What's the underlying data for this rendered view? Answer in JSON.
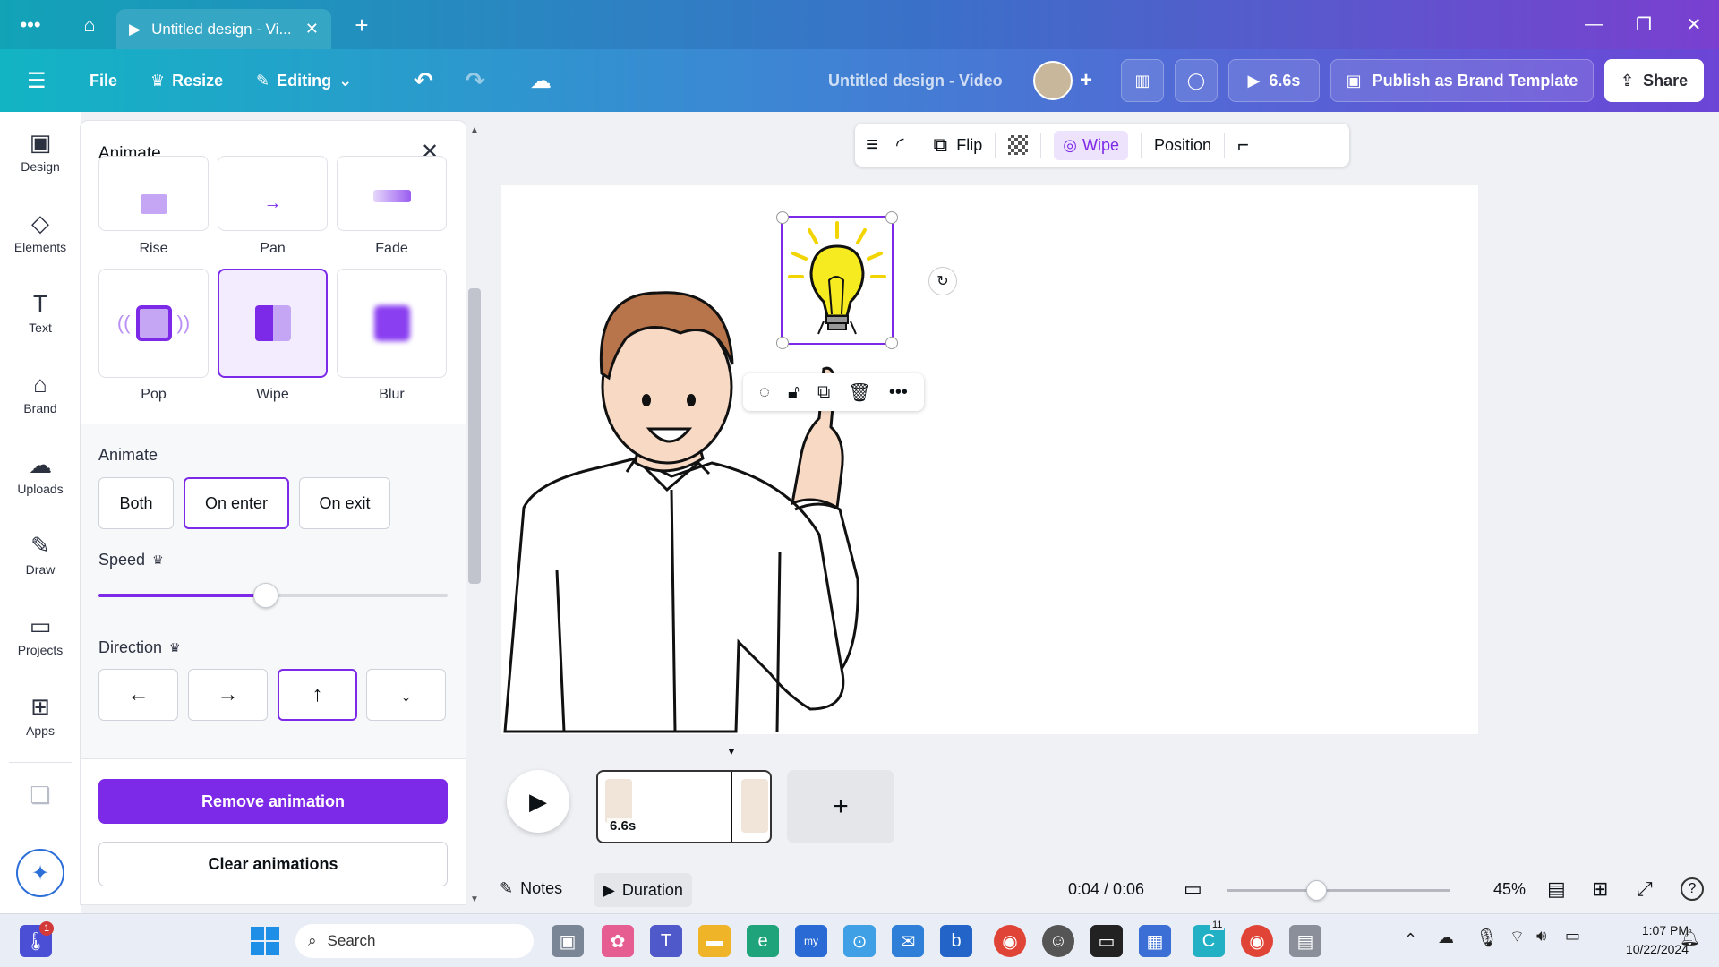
{
  "titlebar": {
    "tab_title": "Untitled design - Vi...",
    "new_tab": "+",
    "close": "✕"
  },
  "header": {
    "file": "File",
    "resize": "Resize",
    "editing": "Editing",
    "doc_title": "Untitled design - Video",
    "play_duration": "6.6s",
    "publish": "Publish as Brand Template",
    "share": "Share"
  },
  "rail": {
    "items": [
      {
        "label": "Design",
        "icon": "▣"
      },
      {
        "label": "Elements",
        "icon": "◇"
      },
      {
        "label": "Text",
        "icon": "T"
      },
      {
        "label": "Brand",
        "icon": "⌂"
      },
      {
        "label": "Uploads",
        "icon": "☁"
      },
      {
        "label": "Draw",
        "icon": "✎"
      },
      {
        "label": "Projects",
        "icon": "▭"
      },
      {
        "label": "Apps",
        "icon": "⊞"
      }
    ]
  },
  "panel": {
    "title": "Animate",
    "effects": [
      "Rise",
      "Pan",
      "Fade",
      "Pop",
      "Wipe",
      "Blur"
    ],
    "animate_label": "Animate",
    "modes": [
      "Both",
      "On enter",
      "On exit"
    ],
    "speed_label": "Speed",
    "speed_value": 0.48,
    "direction_label": "Direction",
    "remove": "Remove animation",
    "clear": "Clear animations"
  },
  "toolbar": {
    "flip": "Flip",
    "wipe": "Wipe",
    "position": "Position"
  },
  "timeline": {
    "clip_duration": "6.6s",
    "notes": "Notes",
    "duration": "Duration",
    "time": "0:04 / 0:06",
    "zoom": "45%",
    "zoom_fraction": 0.4
  },
  "taskbar": {
    "search": "Search",
    "time": "1:07 PM",
    "date": "10/22/2024",
    "notif": "1",
    "canva_badge": "11"
  }
}
